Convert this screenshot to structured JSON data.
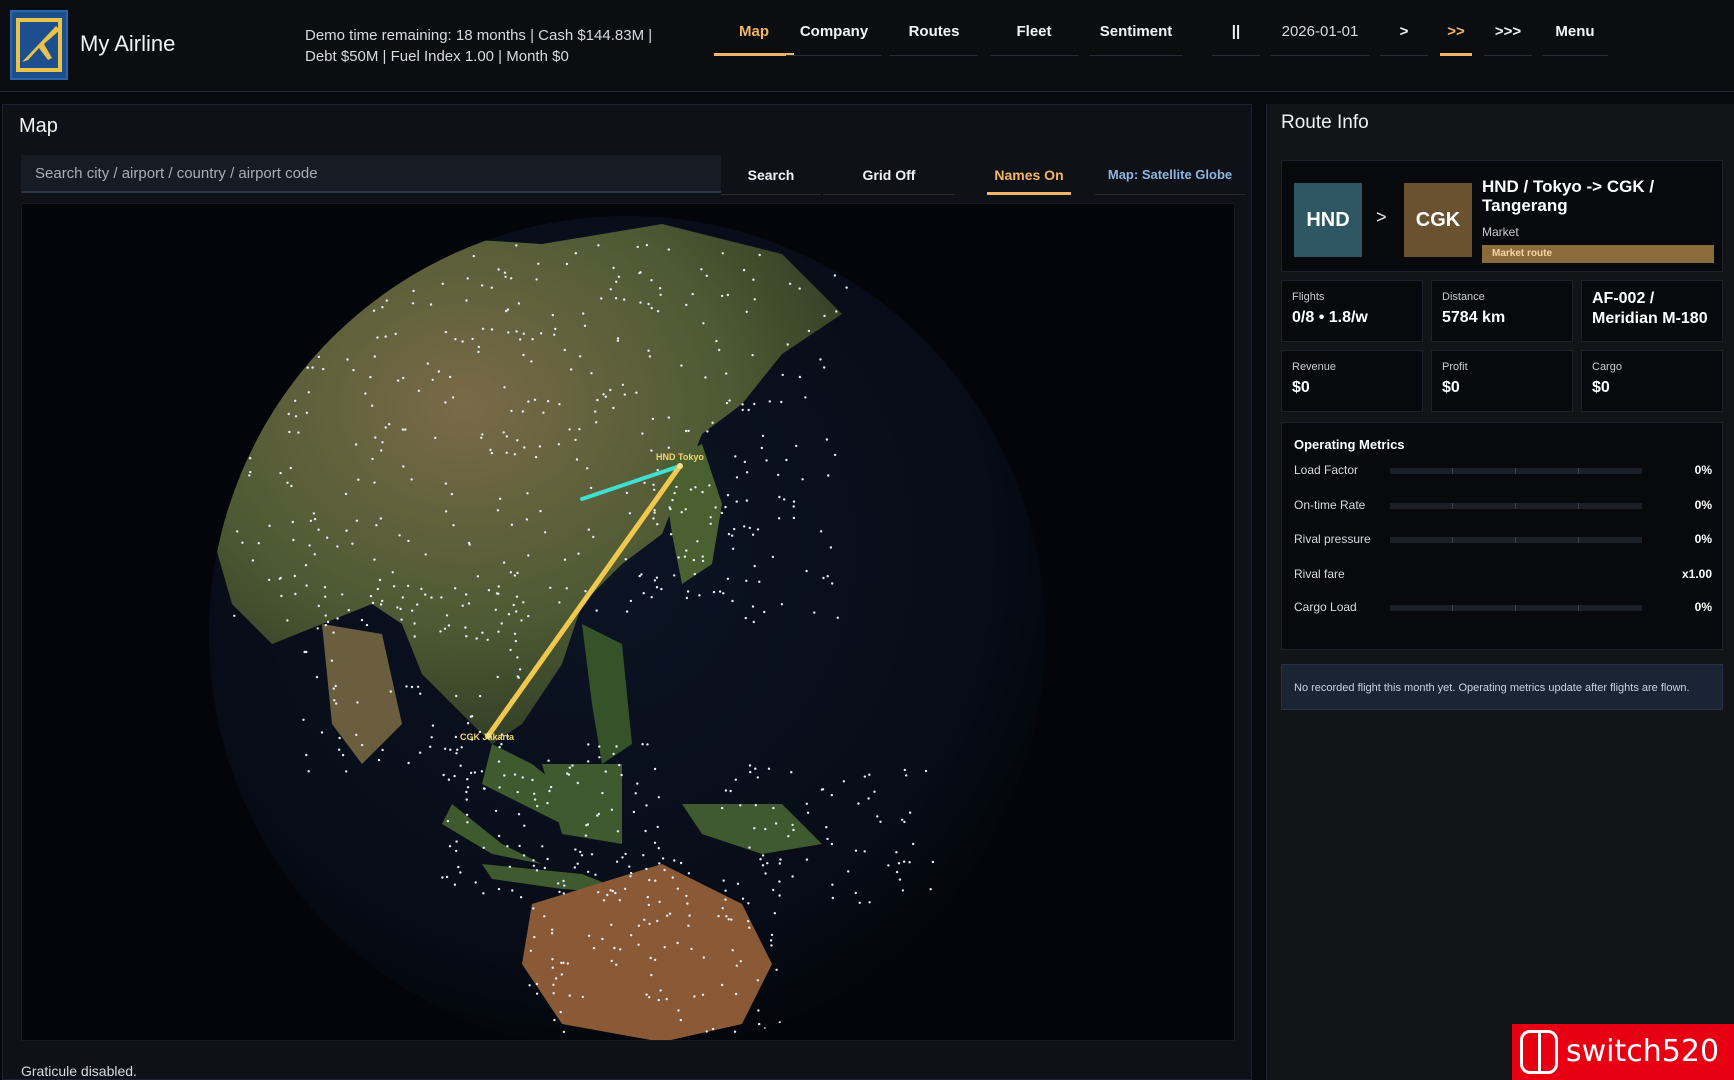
{
  "header": {
    "title": "My Airline",
    "status_line1": "Demo time remaining: 18 months  |  Cash $144.83M  |",
    "status_line2": "Debt $50M  |  Fuel Index 1.00  |  Month $0",
    "nav": {
      "map": "Map",
      "company": "Company",
      "routes": "Routes",
      "fleet": "Fleet",
      "sentiment": "Sentiment",
      "pause": "||",
      "date": "2026-01-01",
      "speed1": ">",
      "speed2": ">>",
      "speed3": ">>>",
      "menu": "Menu"
    }
  },
  "map": {
    "title": "Map",
    "search_placeholder": "Search city / airport / country / airport code",
    "search_button": "Search",
    "grid_button": "Grid Off",
    "names_button": "Names On",
    "style_button": "Map: Satellite Globe",
    "label_origin": "HND  Tokyo",
    "label_dest": "CGK  Jakarta",
    "footer": "Graticule disabled."
  },
  "route": {
    "panel_title": "Route Info",
    "from_code": "HND",
    "to_code": "CGK",
    "arrow": ">",
    "name": "HND / Tokyo -> CGK / Tangerang",
    "market": "Market",
    "tag": "Market route",
    "stats": {
      "flights_label": "Flights",
      "flights_value": "0/8 • 1.8/w",
      "distance_label": "Distance",
      "distance_value": "5784 km",
      "aircraft_value": "AF-002 / Meridian M-180",
      "revenue_label": "Revenue",
      "revenue_value": "$0",
      "profit_label": "Profit",
      "profit_value": "$0",
      "cargo_label": "Cargo",
      "cargo_value": "$0"
    },
    "metrics_title": "Operating Metrics",
    "metrics": [
      {
        "label": "Load Factor",
        "value": "0%",
        "fill": 0
      },
      {
        "label": "On-time Rate",
        "value": "0%",
        "fill": 0
      },
      {
        "label": "Rival pressure",
        "value": "0%",
        "fill": 0
      },
      {
        "label": "Rival fare",
        "value": "x1.00"
      },
      {
        "label": "Cargo Load",
        "value": "0%",
        "fill": 0
      }
    ],
    "notice": "No recorded flight this month yet. Operating metrics update after flights are flown."
  },
  "watermark": "switch520",
  "colors": {
    "accent": "#f3b565",
    "route_primary": "#f0c850",
    "route_secondary": "#3fe0d0",
    "panel_bg": "#07090c"
  }
}
